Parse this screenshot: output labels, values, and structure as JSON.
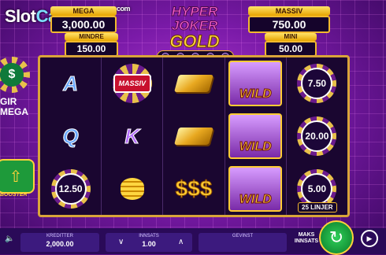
{
  "watermark": {
    "a": "Slot",
    "b": "Catalog",
    "c": ".com"
  },
  "logo": {
    "line1": "HYPER JOKER",
    "line2": "GOLD"
  },
  "jackpots": {
    "mega": {
      "label": "MEGA",
      "value": "3,000.00"
    },
    "mindre": {
      "label": "MINDRE",
      "value": "150.00"
    },
    "massiv": {
      "label": "MASSIV",
      "value": "750.00"
    },
    "mini": {
      "label": "MINI",
      "value": "50.00"
    }
  },
  "reels": {
    "r1": [
      "A",
      "Q",
      "12.50"
    ],
    "r2": [
      "MASSIV",
      "K",
      ""
    ],
    "r4": [
      "WILD",
      "WILD",
      "WILD"
    ],
    "r5": [
      "7.50",
      "20.00",
      "5.00"
    ]
  },
  "lines_label": "25 LINJER",
  "left": {
    "gir_icon": "$",
    "gir_text1": "GIR",
    "gir_text2": "MEGA",
    "booster": "BOOSTER"
  },
  "bottom": {
    "credits_label": "KREDITTER",
    "credits_value": "2,000.00",
    "bet_label": "INNSATS",
    "bet_value": "1.00",
    "win_label": "GEVINST",
    "win_value": "",
    "max_bet_label": "MAKS INNSATS",
    "spin_icon": "↻",
    "autoplay_icon": "▶",
    "sound_icon": "🔈"
  }
}
